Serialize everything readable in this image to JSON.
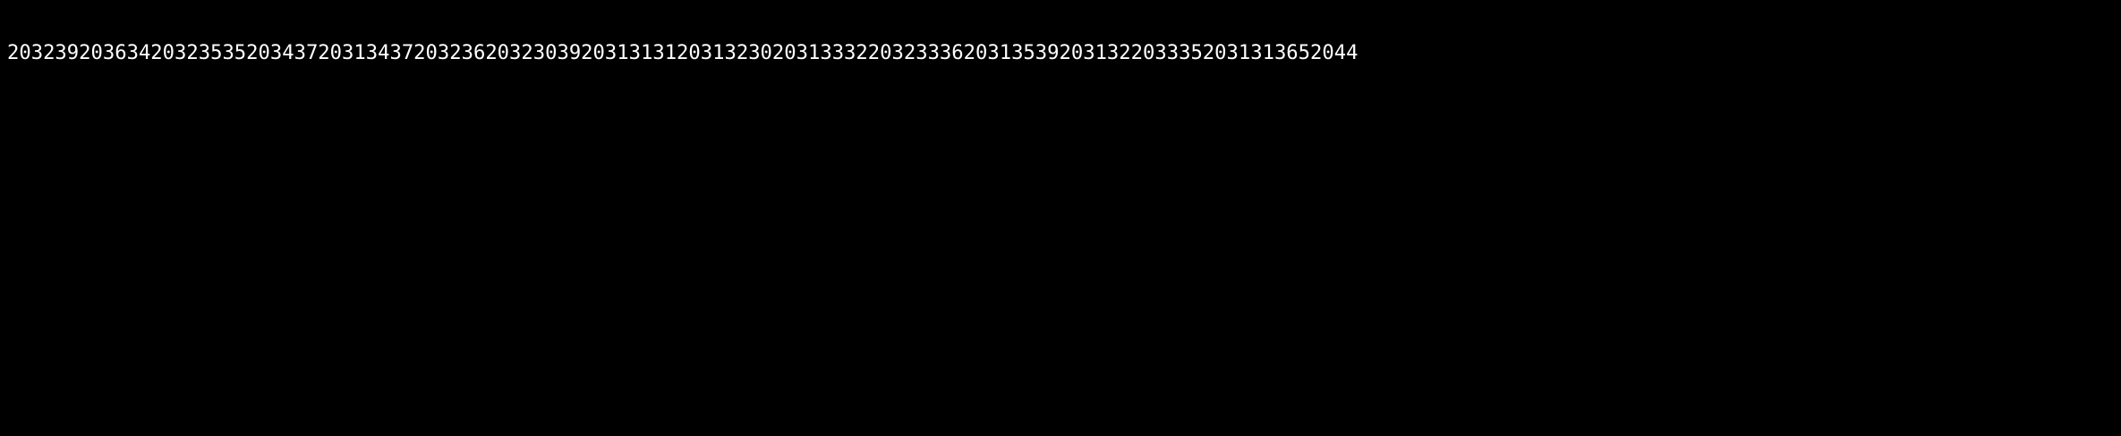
{
  "lines": [
    {
      "text": "20323920363420323535203437203134372032362032303920313131203132302031333220323336203135392031322033352031313652044"
    },
    {
      "text": "20323920363420323535203437203134372032362032303920313131203132302031333220323336203135392031322033352031313652044"
    },
    {
      "text": "20323920363420323535203437203134372032362032303920313131203132302031333220323336203135392031322033352031313652044"
    },
    {
      "text": "20323920363420323535203437203134372032362032303920313131203132302031333220323336203135392031322033352031313652044"
    },
    {
      "text": "20323920363420323535203437203134372032362032303920313131203132302031333220323336203135392031322033352031313652044"
    },
    {
      "text": "20323920363420323535203437203134372032362032303920313131203132302031333220323336203135392031322033352031313652044"
    },
    {
      "text": "20323920363420323535203437203134372032362032303920313131203132302031333220323336203135392031322033352031313652044"
    },
    {
      "text": "20323920363420323535203437203134372032362032303920313131203132302031333220323336203135392031322033352031313652044"
    }
  ]
}
